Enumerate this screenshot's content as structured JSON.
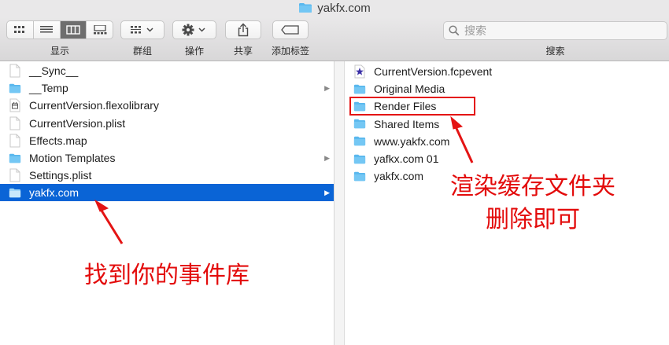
{
  "window": {
    "title": "yakfx.com"
  },
  "toolbar": {
    "view_label": "显示",
    "group_label": "群组",
    "action_label": "操作",
    "share_label": "共享",
    "tags_label": "添加标签",
    "search_label": "搜索",
    "search_placeholder": "搜索",
    "view_modes": [
      "icon-view-icon",
      "list-view-icon",
      "column-view-icon",
      "gallery-view-icon"
    ],
    "active_view": "column-view-icon"
  },
  "left_column": {
    "items": [
      {
        "name": "__Sync__",
        "icon": "document-icon",
        "has_children": false
      },
      {
        "name": "__Temp",
        "icon": "folder-icon",
        "has_children": true
      },
      {
        "name": "CurrentVersion.flexolibrary",
        "icon": "library-document-icon",
        "has_children": false
      },
      {
        "name": "CurrentVersion.plist",
        "icon": "document-icon",
        "has_children": false
      },
      {
        "name": "Effects.map",
        "icon": "document-icon",
        "has_children": false
      },
      {
        "name": "Motion Templates",
        "icon": "folder-icon",
        "has_children": true
      },
      {
        "name": "Settings.plist",
        "icon": "document-icon",
        "has_children": false
      },
      {
        "name": "yakfx.com",
        "icon": "folder-icon",
        "has_children": true,
        "selected": true
      }
    ]
  },
  "right_column": {
    "items": [
      {
        "name": "CurrentVersion.fcpevent",
        "icon": "star-document-icon"
      },
      {
        "name": "Original Media",
        "icon": "folder-icon"
      },
      {
        "name": "Render Files",
        "icon": "folder-icon",
        "highlighted": true
      },
      {
        "name": "Shared Items",
        "icon": "folder-icon"
      },
      {
        "name": "www.yakfx.com",
        "icon": "folder-icon"
      },
      {
        "name": "yafkx.com 01",
        "icon": "folder-icon"
      },
      {
        "name": "yakfx.com",
        "icon": "folder-icon"
      }
    ]
  },
  "annotations": {
    "find_library": "找到你的事件库",
    "delete_cache_line1": "渲染缓存文件夹",
    "delete_cache_line2": "删除即可"
  },
  "colors": {
    "selection": "#0a64d6",
    "annotation_red": "#e30b0b",
    "folder_blue": "#5ab8ee"
  }
}
